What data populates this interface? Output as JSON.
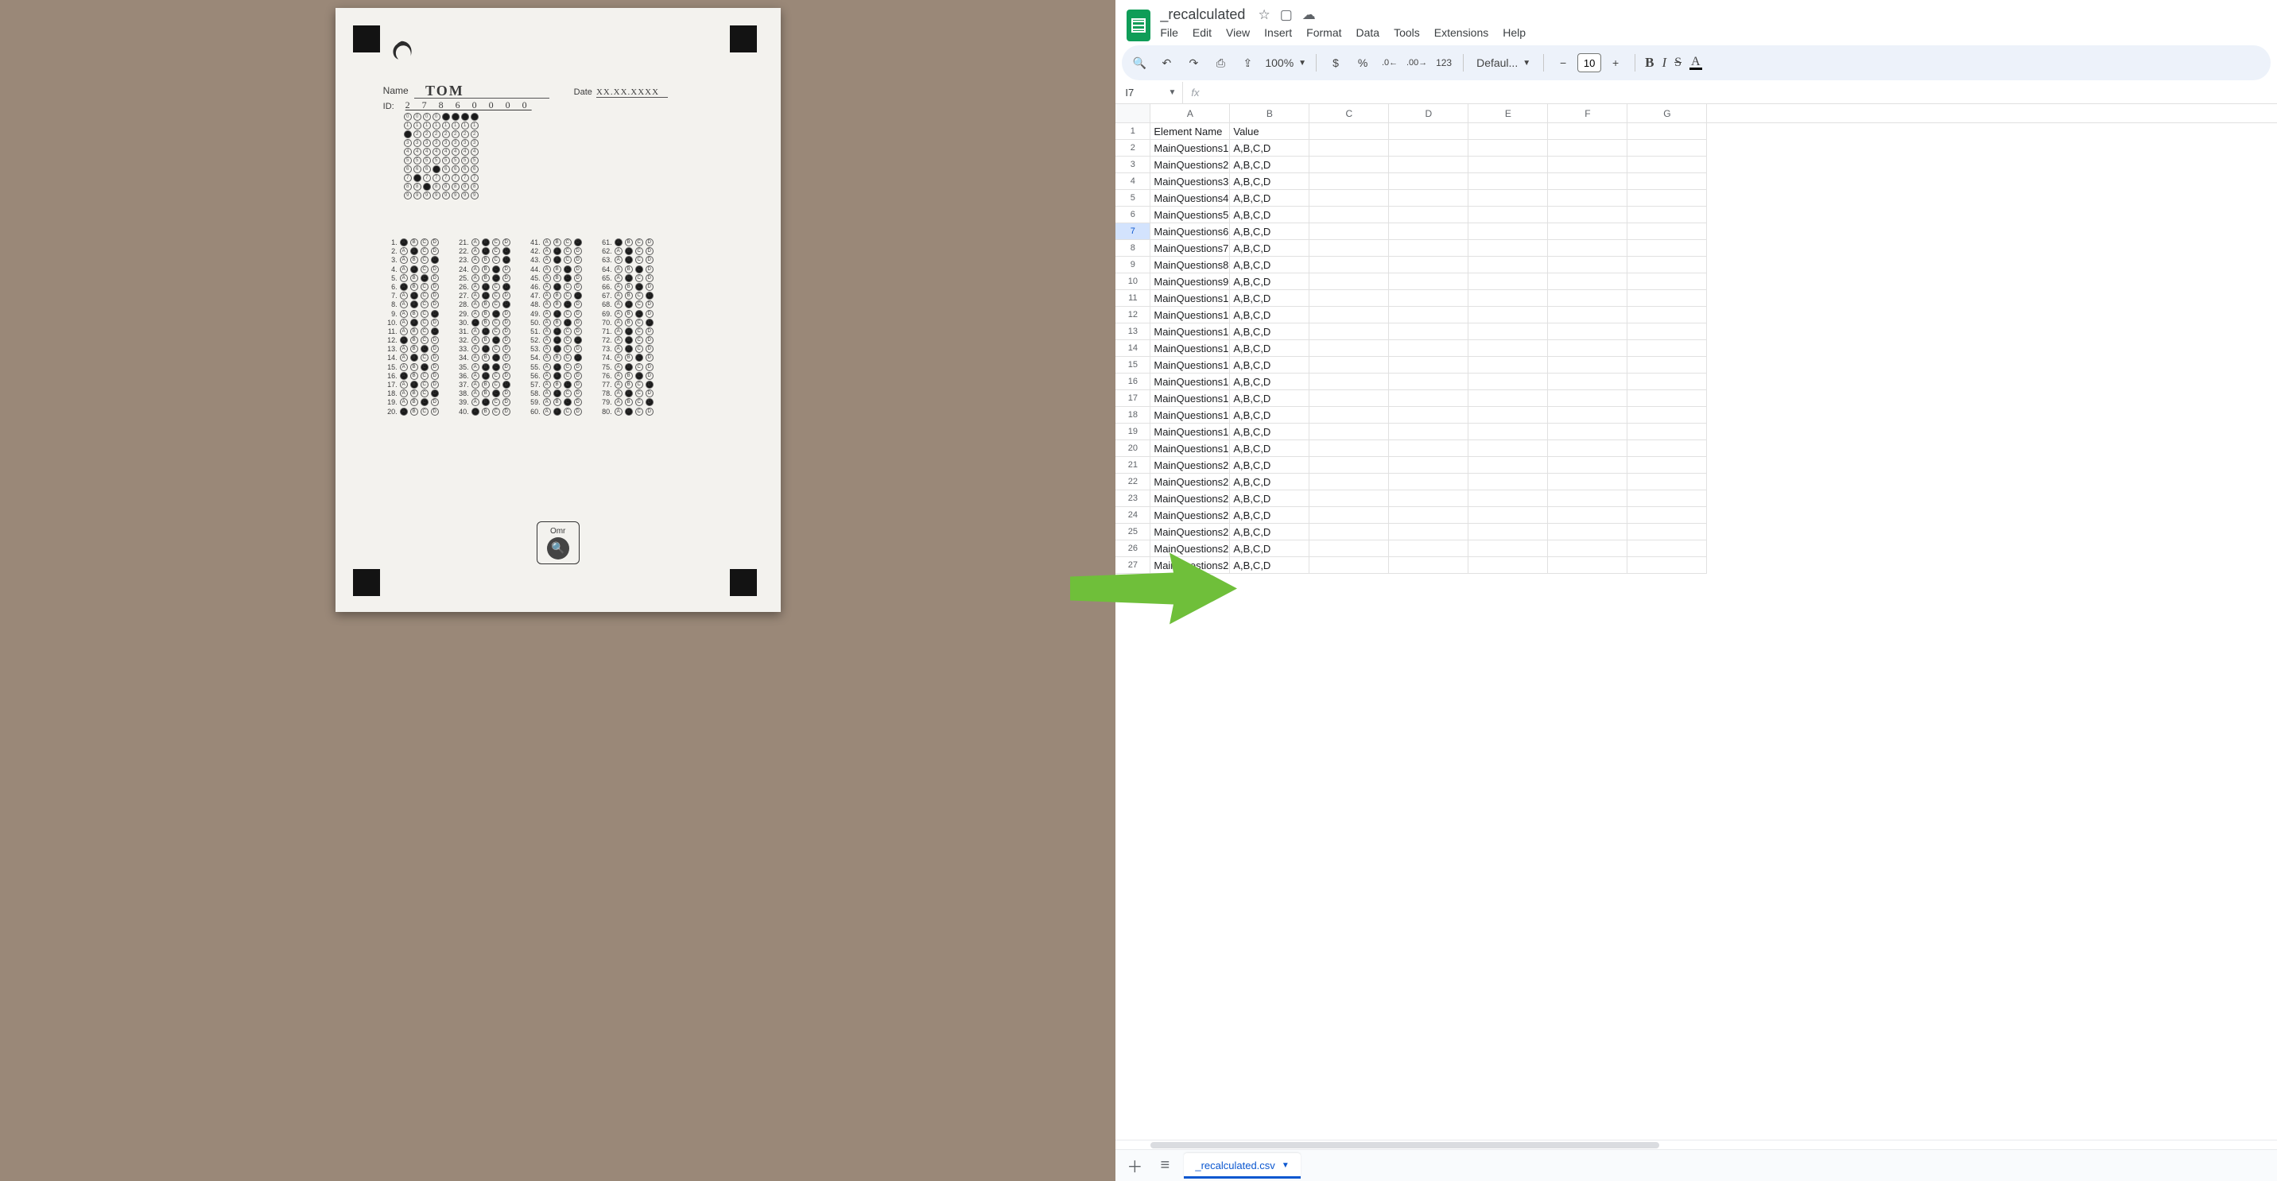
{
  "omr": {
    "name_label": "Name",
    "name_value": "TOM",
    "date_label": "Date",
    "date_value": "XX.XX.XXXX",
    "id_label": "ID:",
    "id_digits": "2 7 8 6 0 0 0 0",
    "badge_text": "Omr"
  },
  "sheets": {
    "doc_title": "_recalculated",
    "menus": [
      "File",
      "Edit",
      "View",
      "Insert",
      "Format",
      "Data",
      "Tools",
      "Extensions",
      "Help"
    ],
    "zoom": "100%",
    "font_name": "Defaul...",
    "font_size": "10",
    "namebox": "I7",
    "fx_label": "fx",
    "columns": [
      "A",
      "B",
      "C",
      "D",
      "E",
      "F",
      "G"
    ],
    "selected_row_header": 7,
    "rows": [
      {
        "n": 1,
        "a": "Element Name",
        "b": "Value"
      },
      {
        "n": 2,
        "a": "MainQuestions1",
        "b": "A,B,C,D"
      },
      {
        "n": 3,
        "a": "MainQuestions2",
        "b": "A,B,C,D"
      },
      {
        "n": 4,
        "a": "MainQuestions3",
        "b": "A,B,C,D"
      },
      {
        "n": 5,
        "a": "MainQuestions4",
        "b": "A,B,C,D"
      },
      {
        "n": 6,
        "a": "MainQuestions5",
        "b": "A,B,C,D"
      },
      {
        "n": 7,
        "a": "MainQuestions6",
        "b": "A,B,C,D"
      },
      {
        "n": 8,
        "a": "MainQuestions7",
        "b": "A,B,C,D"
      },
      {
        "n": 9,
        "a": "MainQuestions8",
        "b": "A,B,C,D"
      },
      {
        "n": 10,
        "a": "MainQuestions9",
        "b": "A,B,C,D"
      },
      {
        "n": 11,
        "a": "MainQuestions1",
        "b": "A,B,C,D"
      },
      {
        "n": 12,
        "a": "MainQuestions1",
        "b": "A,B,C,D"
      },
      {
        "n": 13,
        "a": "MainQuestions1",
        "b": "A,B,C,D"
      },
      {
        "n": 14,
        "a": "MainQuestions1",
        "b": "A,B,C,D"
      },
      {
        "n": 15,
        "a": "MainQuestions1",
        "b": "A,B,C,D"
      },
      {
        "n": 16,
        "a": "MainQuestions1",
        "b": "A,B,C,D"
      },
      {
        "n": 17,
        "a": "MainQuestions1",
        "b": "A,B,C,D"
      },
      {
        "n": 18,
        "a": "MainQuestions1",
        "b": "A,B,C,D"
      },
      {
        "n": 19,
        "a": "MainQuestions1",
        "b": "A,B,C,D"
      },
      {
        "n": 20,
        "a": "MainQuestions1",
        "b": "A,B,C,D"
      },
      {
        "n": 21,
        "a": "MainQuestions2",
        "b": "A,B,C,D"
      },
      {
        "n": 22,
        "a": "MainQuestions2",
        "b": "A,B,C,D"
      },
      {
        "n": 23,
        "a": "MainQuestions2",
        "b": "A,B,C,D"
      },
      {
        "n": 24,
        "a": "MainQuestions2",
        "b": "A,B,C,D"
      },
      {
        "n": 25,
        "a": "MainQuestions2",
        "b": "A,B,C,D"
      },
      {
        "n": 26,
        "a": "MainQuestions2",
        "b": "A,B,C,D"
      },
      {
        "n": 27,
        "a": "MainQuestions2",
        "b": "A,B,C,D"
      }
    ],
    "sheet_tab": "_recalculated.csv",
    "icons": {
      "star": "☆",
      "move": "▢",
      "cloud": "☁",
      "search": "🔍",
      "undo": "↶",
      "redo": "↷",
      "print": "⎙",
      "paint": "⇪",
      "currency": "$",
      "percent": "%",
      "dec_dec": ".0←",
      "dec_inc": ".00→",
      "numfmt": "123",
      "minus": "−",
      "plus": "+"
    }
  },
  "id_grid_filled": [
    [
      0,
      0,
      0,
      0,
      1,
      1,
      1,
      1
    ],
    [
      0,
      0,
      0,
      0,
      0,
      0,
      0,
      0
    ],
    [
      1,
      0,
      0,
      0,
      0,
      0,
      0,
      0
    ],
    [
      0,
      0,
      0,
      0,
      0,
      0,
      0,
      0
    ],
    [
      0,
      0,
      0,
      0,
      0,
      0,
      0,
      0
    ],
    [
      0,
      0,
      0,
      0,
      0,
      0,
      0,
      0
    ],
    [
      0,
      0,
      0,
      1,
      0,
      0,
      0,
      0
    ],
    [
      0,
      1,
      0,
      0,
      0,
      0,
      0,
      0
    ],
    [
      0,
      0,
      1,
      0,
      0,
      0,
      0,
      0
    ],
    [
      0,
      0,
      0,
      0,
      0,
      0,
      0,
      0
    ]
  ],
  "answers_filled": {
    "1": [
      1,
      0,
      0,
      0
    ],
    "2": [
      0,
      1,
      0,
      0
    ],
    "3": [
      0,
      0,
      0,
      1
    ],
    "4": [
      0,
      1,
      0,
      0
    ],
    "5": [
      0,
      0,
      1,
      0
    ],
    "6": [
      1,
      0,
      0,
      0
    ],
    "7": [
      0,
      1,
      0,
      0
    ],
    "8": [
      0,
      1,
      0,
      0
    ],
    "9": [
      0,
      0,
      0,
      1
    ],
    "10": [
      0,
      1,
      0,
      0
    ],
    "11": [
      0,
      0,
      0,
      1
    ],
    "12": [
      1,
      0,
      0,
      0
    ],
    "13": [
      0,
      0,
      1,
      0
    ],
    "14": [
      0,
      1,
      0,
      0
    ],
    "15": [
      0,
      0,
      1,
      0
    ],
    "16": [
      1,
      0,
      0,
      0
    ],
    "17": [
      0,
      1,
      0,
      0
    ],
    "18": [
      0,
      0,
      0,
      1
    ],
    "19": [
      0,
      0,
      1,
      0
    ],
    "20": [
      1,
      0,
      0,
      0
    ],
    "21": [
      0,
      1,
      0,
      0
    ],
    "22": [
      0,
      1,
      0,
      1
    ],
    "23": [
      0,
      0,
      0,
      1
    ],
    "24": [
      0,
      0,
      1,
      0
    ],
    "25": [
      0,
      0,
      1,
      0
    ],
    "26": [
      0,
      1,
      0,
      1
    ],
    "27": [
      0,
      1,
      0,
      0
    ],
    "28": [
      0,
      0,
      0,
      1
    ],
    "29": [
      0,
      0,
      1,
      0
    ],
    "30": [
      1,
      0,
      0,
      0
    ],
    "31": [
      0,
      1,
      0,
      0
    ],
    "32": [
      0,
      0,
      1,
      0
    ],
    "33": [
      0,
      1,
      0,
      0
    ],
    "34": [
      0,
      0,
      1,
      0
    ],
    "35": [
      0,
      1,
      1,
      0
    ],
    "36": [
      0,
      1,
      0,
      0
    ],
    "37": [
      0,
      0,
      0,
      1
    ],
    "38": [
      0,
      0,
      1,
      0
    ],
    "39": [
      0,
      1,
      0,
      0
    ],
    "40": [
      1,
      0,
      0,
      0
    ],
    "41": [
      0,
      0,
      0,
      1
    ],
    "42": [
      0,
      1,
      0,
      0
    ],
    "43": [
      0,
      1,
      0,
      0
    ],
    "44": [
      0,
      0,
      1,
      0
    ],
    "45": [
      0,
      0,
      1,
      0
    ],
    "46": [
      0,
      1,
      0,
      0
    ],
    "47": [
      0,
      0,
      0,
      1
    ],
    "48": [
      0,
      0,
      1,
      0
    ],
    "49": [
      0,
      1,
      0,
      0
    ],
    "50": [
      0,
      0,
      1,
      0
    ],
    "51": [
      0,
      1,
      0,
      0
    ],
    "52": [
      0,
      1,
      0,
      1
    ],
    "53": [
      0,
      1,
      0,
      0
    ],
    "54": [
      0,
      0,
      0,
      1
    ],
    "55": [
      0,
      1,
      0,
      0
    ],
    "56": [
      0,
      1,
      0,
      0
    ],
    "57": [
      0,
      0,
      1,
      0
    ],
    "58": [
      0,
      1,
      0,
      0
    ],
    "59": [
      0,
      0,
      1,
      0
    ],
    "60": [
      0,
      1,
      0,
      0
    ],
    "61": [
      1,
      0,
      0,
      0
    ],
    "62": [
      0,
      1,
      0,
      0
    ],
    "63": [
      0,
      1,
      0,
      0
    ],
    "64": [
      0,
      0,
      1,
      0
    ],
    "65": [
      0,
      1,
      0,
      0
    ],
    "66": [
      0,
      0,
      1,
      0
    ],
    "67": [
      0,
      0,
      0,
      1
    ],
    "68": [
      0,
      1,
      0,
      0
    ],
    "69": [
      0,
      0,
      1,
      0
    ],
    "70": [
      0,
      0,
      0,
      1
    ],
    "71": [
      0,
      1,
      0,
      0
    ],
    "72": [
      0,
      1,
      0,
      0
    ],
    "73": [
      0,
      1,
      0,
      0
    ],
    "74": [
      0,
      0,
      1,
      0
    ],
    "75": [
      0,
      1,
      0,
      0
    ],
    "76": [
      0,
      0,
      1,
      0
    ],
    "77": [
      0,
      0,
      0,
      1
    ],
    "78": [
      0,
      1,
      0,
      0
    ],
    "79": [
      0,
      0,
      0,
      1
    ],
    "80": [
      0,
      1,
      0,
      0
    ]
  }
}
